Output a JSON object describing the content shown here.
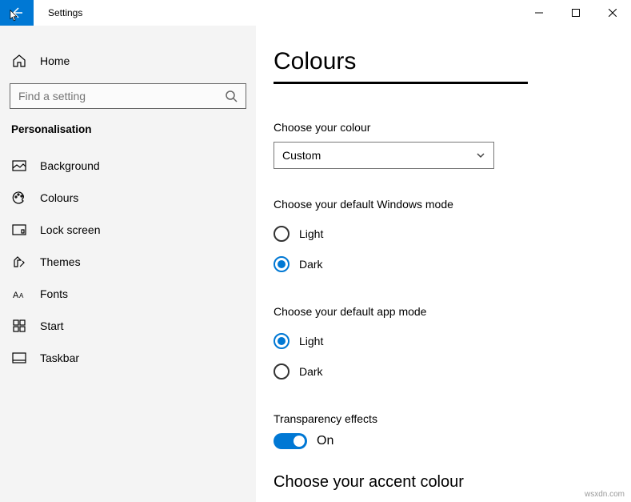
{
  "window": {
    "title": "Settings"
  },
  "sidebar": {
    "home": "Home",
    "search_placeholder": "Find a setting",
    "category": "Personalisation",
    "items": [
      {
        "label": "Background"
      },
      {
        "label": "Colours"
      },
      {
        "label": "Lock screen"
      },
      {
        "label": "Themes"
      },
      {
        "label": "Fonts"
      },
      {
        "label": "Start"
      },
      {
        "label": "Taskbar"
      }
    ]
  },
  "main": {
    "title": "Colours",
    "choose_colour_label": "Choose your colour",
    "choose_colour_value": "Custom",
    "windows_mode_label": "Choose your default Windows mode",
    "windows_mode": {
      "light": "Light",
      "dark": "Dark",
      "selected": "dark"
    },
    "app_mode_label": "Choose your default app mode",
    "app_mode": {
      "light": "Light",
      "dark": "Dark",
      "selected": "light"
    },
    "transparency_label": "Transparency effects",
    "transparency_state": "On",
    "accent_label": "Choose your accent colour"
  },
  "watermark": "wsxdn.com"
}
